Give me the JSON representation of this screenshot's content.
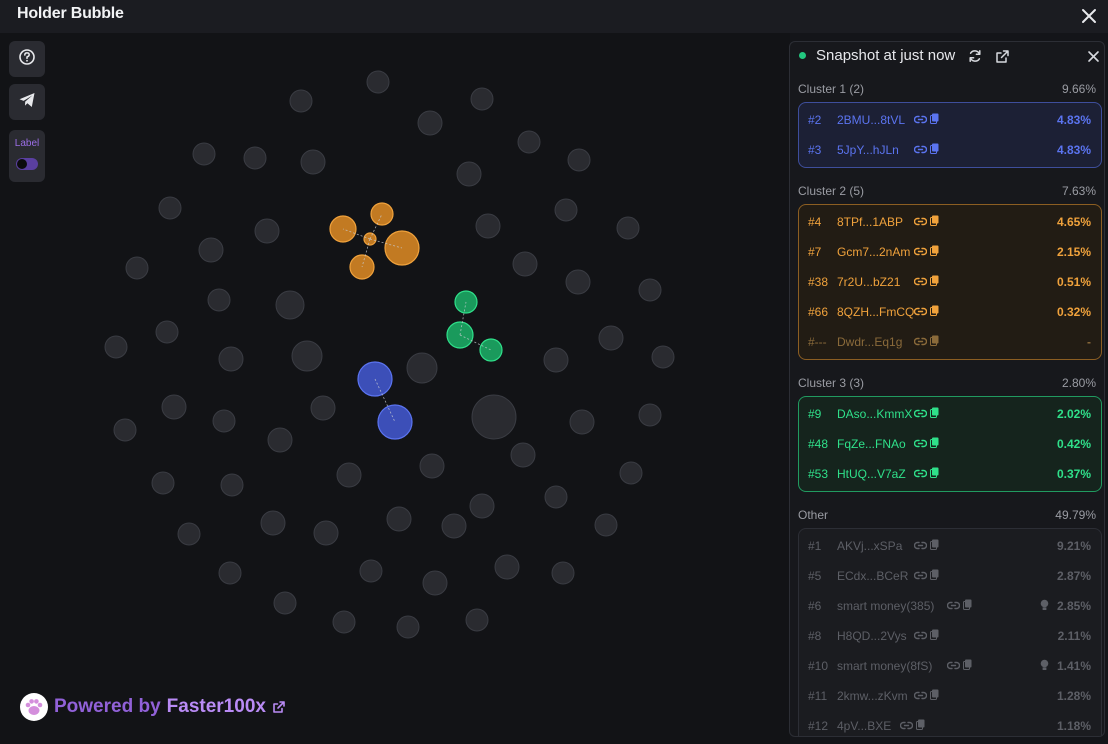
{
  "app_title": "Holder Bubble",
  "toolbar": {
    "label_text": "Label"
  },
  "powered": {
    "prefix": "Powered by",
    "brand": "Faster100x"
  },
  "panel": {
    "title": "Snapshot at just now"
  },
  "colors": {
    "cluster1": "#5b74f0",
    "cluster2": "#f0a23c",
    "cluster3": "#2fe08a",
    "other": "#55575e",
    "accent": "#b98bf5",
    "live": "#22c77f"
  },
  "clusters": [
    {
      "name": "Cluster 1 (2)",
      "pct": "9.66%",
      "rows": [
        {
          "rank": "#2",
          "addr": "2BMU...8tVL",
          "pct": "4.83%"
        },
        {
          "rank": "#3",
          "addr": "5JpY...hJLn",
          "pct": "4.83%"
        }
      ]
    },
    {
      "name": "Cluster 2 (5)",
      "pct": "7.63%",
      "rows": [
        {
          "rank": "#4",
          "addr": "8TPf...1ABP",
          "pct": "4.65%"
        },
        {
          "rank": "#7",
          "addr": "Gcm7...2nAm",
          "pct": "2.15%"
        },
        {
          "rank": "#38",
          "addr": "7r2U...bZ21",
          "pct": "0.51%"
        },
        {
          "rank": "#66",
          "addr": "8QZH...FmCQ",
          "pct": "0.32%"
        },
        {
          "rank": "#---",
          "addr": "Dwdr...Eq1g",
          "pct": "-"
        }
      ]
    },
    {
      "name": "Cluster 3 (3)",
      "pct": "2.80%",
      "rows": [
        {
          "rank": "#9",
          "addr": "DAso...KmmX",
          "pct": "2.02%"
        },
        {
          "rank": "#48",
          "addr": "FqZe...FNAo",
          "pct": "0.42%"
        },
        {
          "rank": "#53",
          "addr": "HtUQ...V7aZ",
          "pct": "0.37%"
        }
      ]
    },
    {
      "name": "Other",
      "pct": "49.79%",
      "rows": [
        {
          "rank": "#1",
          "addr": "AKVj...xSPa",
          "pct": "9.21%"
        },
        {
          "rank": "#5",
          "addr": "ECdx...BCeR",
          "pct": "2.87%"
        },
        {
          "rank": "#6",
          "addr": "smart money(385)",
          "pct": "2.85%",
          "bulb": true
        },
        {
          "rank": "#8",
          "addr": "H8QD...2Vys",
          "pct": "2.11%"
        },
        {
          "rank": "#10",
          "addr": "smart money(8fS)",
          "pct": "1.41%",
          "bulb": true
        },
        {
          "rank": "#11",
          "addr": "2kmw...zKvm",
          "pct": "1.28%"
        },
        {
          "rank": "#12",
          "addr": "4pV...BXE",
          "pct": "1.18%"
        }
      ]
    }
  ],
  "bubbles": {
    "other": [
      [
        378,
        82,
        11
      ],
      [
        301,
        101,
        11
      ],
      [
        482,
        99,
        11
      ],
      [
        430,
        123,
        12
      ],
      [
        204,
        154,
        11
      ],
      [
        255,
        158,
        11
      ],
      [
        313,
        162,
        12
      ],
      [
        529,
        142,
        11
      ],
      [
        579,
        160,
        11
      ],
      [
        469,
        174,
        12
      ],
      [
        170,
        208,
        11
      ],
      [
        267,
        231,
        12
      ],
      [
        566,
        210,
        11
      ],
      [
        488,
        226,
        12
      ],
      [
        628,
        228,
        11
      ],
      [
        211,
        250,
        12
      ],
      [
        137,
        268,
        11
      ],
      [
        525,
        264,
        12
      ],
      [
        578,
        282,
        12
      ],
      [
        290,
        305,
        14
      ],
      [
        219,
        300,
        11
      ],
      [
        650,
        290,
        11
      ],
      [
        167,
        332,
        11
      ],
      [
        116,
        347,
        11
      ],
      [
        611,
        338,
        12
      ],
      [
        556,
        360,
        12
      ],
      [
        307,
        356,
        15
      ],
      [
        422,
        368,
        15
      ],
      [
        231,
        359,
        12
      ],
      [
        663,
        357,
        11
      ],
      [
        174,
        407,
        12
      ],
      [
        323,
        408,
        12
      ],
      [
        494,
        417,
        22
      ],
      [
        125,
        430,
        11
      ],
      [
        280,
        440,
        12
      ],
      [
        650,
        415,
        11
      ],
      [
        582,
        422,
        12
      ],
      [
        224,
        421,
        11
      ],
      [
        523,
        455,
        12
      ],
      [
        432,
        466,
        12
      ],
      [
        349,
        475,
        12
      ],
      [
        163,
        483,
        11
      ],
      [
        232,
        485,
        11
      ],
      [
        631,
        473,
        11
      ],
      [
        454,
        526,
        12
      ],
      [
        556,
        497,
        11
      ],
      [
        482,
        506,
        12
      ],
      [
        273,
        523,
        12
      ],
      [
        189,
        534,
        11
      ],
      [
        326,
        533,
        12
      ],
      [
        399,
        519,
        12
      ],
      [
        606,
        525,
        11
      ],
      [
        230,
        573,
        11
      ],
      [
        371,
        571,
        11
      ],
      [
        435,
        583,
        12
      ],
      [
        507,
        567,
        12
      ],
      [
        563,
        573,
        11
      ],
      [
        285,
        603,
        11
      ],
      [
        344,
        622,
        11
      ],
      [
        408,
        627,
        11
      ],
      [
        477,
        620,
        11
      ]
    ],
    "cluster1": [
      [
        375,
        379,
        17
      ],
      [
        395,
        422,
        17
      ]
    ],
    "cluster2": [
      [
        343,
        229,
        13
      ],
      [
        382,
        214,
        11
      ],
      [
        402,
        248,
        17
      ],
      [
        362,
        267,
        12
      ],
      [
        370,
        239,
        6
      ]
    ],
    "cluster3": [
      [
        466,
        302,
        11
      ],
      [
        460,
        335,
        13
      ],
      [
        491,
        350,
        11
      ]
    ]
  },
  "links": {
    "cluster1": [
      [
        375,
        379,
        395,
        422
      ]
    ],
    "cluster2": [
      [
        370,
        239,
        343,
        229
      ],
      [
        370,
        239,
        382,
        214
      ],
      [
        370,
        239,
        402,
        248
      ],
      [
        370,
        239,
        362,
        267
      ]
    ],
    "cluster3": [
      [
        460,
        335,
        466,
        302
      ],
      [
        460,
        335,
        491,
        350
      ]
    ]
  }
}
